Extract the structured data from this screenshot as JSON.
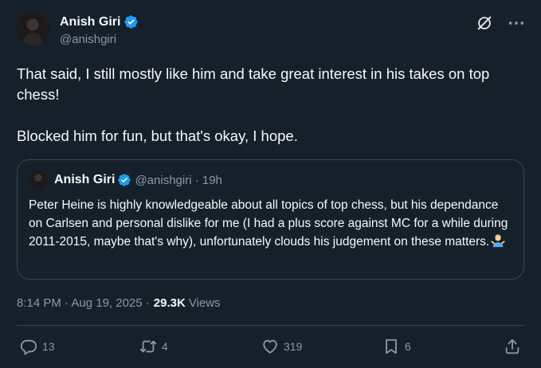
{
  "author": {
    "name": "Anish Giri",
    "handle": "@anishgiri"
  },
  "tweet": {
    "text": "That said, I still mostly like him and take great interest in his takes on top chess!\n\nBlocked him for fun, but that's okay, I hope."
  },
  "quoted": {
    "name": "Anish Giri",
    "handle_time": "@anishgiri · 19h",
    "text": "Peter Heine is highly knowledgeable about all topics of top chess, but his dependance on Carlsen and personal dislike for me (I had a plus score against MC for a while during 2011-2015, maybe that's why), unfortunately clouds his judgement on these matters.",
    "emoji": "person-shrugging-emoji"
  },
  "meta": {
    "datetime": "8:14 PM · Aug 19, 2025 · ",
    "views_count": "29.3K",
    "views_label": "Views"
  },
  "actions": {
    "reply_count": "13",
    "repost_count": "4",
    "like_count": "319",
    "bookmark_count": "6"
  },
  "icons": [
    "verified-badge-icon",
    "grok-icon",
    "more-icon",
    "reply-icon",
    "repost-icon",
    "like-icon",
    "bookmark-icon",
    "share-icon"
  ],
  "colors": {
    "background": "#15202b",
    "text": "#f7f9f9",
    "secondary": "#8b98a5",
    "border": "#38444d",
    "verified": "#1d9bf0"
  }
}
